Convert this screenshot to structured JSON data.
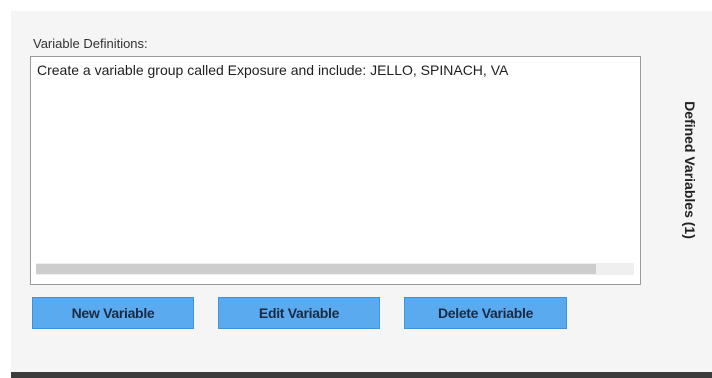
{
  "variable_definitions": {
    "label": "Variable Definitions:",
    "items": [
      "Create a variable group called Exposure and include: JELLO, SPINACH, VA"
    ]
  },
  "buttons": {
    "new": "New Variable",
    "edit": "Edit Variable",
    "delete": "Delete Variable"
  },
  "side_tab": {
    "label": "Defined Variables (1)"
  },
  "colors": {
    "button": "#5aaaf0",
    "panel": "#f5f5f5"
  }
}
